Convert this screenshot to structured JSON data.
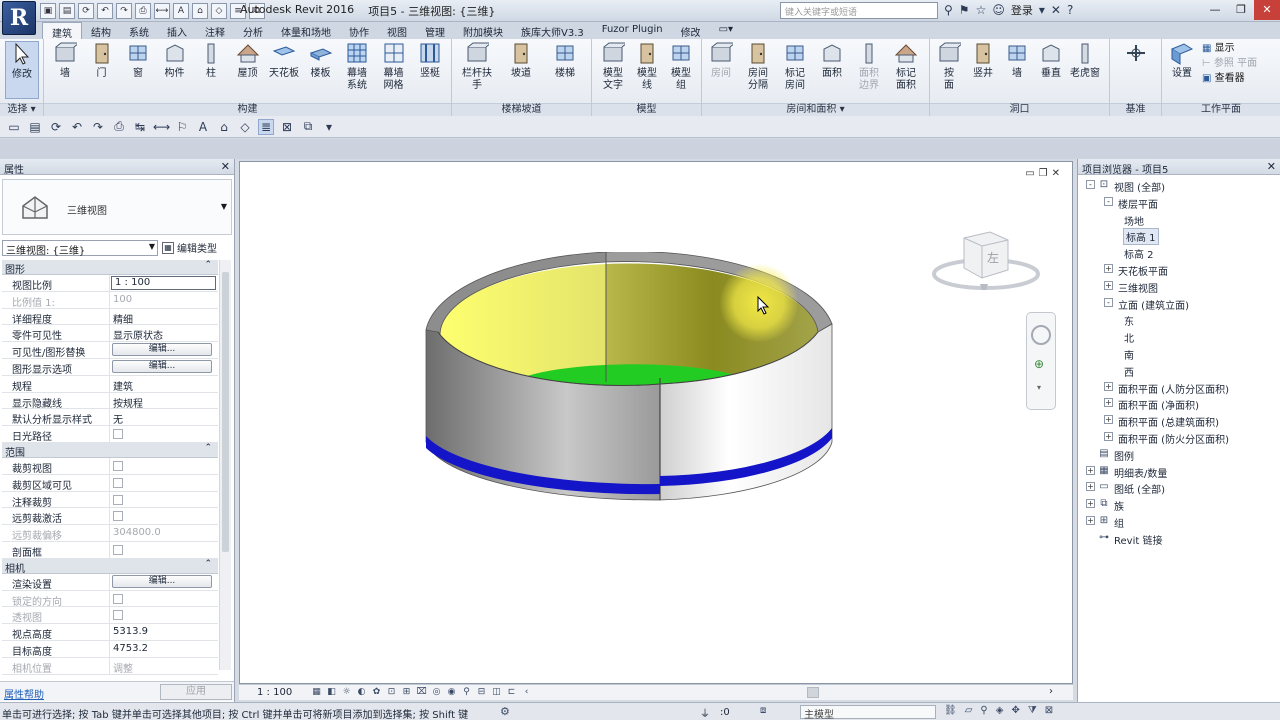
{
  "title_bar": {
    "app_title": "Autodesk Revit 2016",
    "project_view": "项目5 - 三维视图: {三维}",
    "search_placeholder": "键入关键字或短语",
    "login_label": "登录"
  },
  "ribbon_tabs": [
    "建筑",
    "结构",
    "系统",
    "插入",
    "注释",
    "分析",
    "体量和场地",
    "协作",
    "视图",
    "管理",
    "附加模块",
    "族库大师V3.3",
    "Fuzor Plugin",
    "修改"
  ],
  "active_tab": "建筑",
  "ribbon": {
    "select": {
      "modify": "修改",
      "label": "选择 ▾"
    },
    "build": {
      "label": "构建",
      "buttons": [
        "墙",
        "门",
        "窗",
        "构件",
        "柱",
        "屋顶",
        "天花板",
        "楼板",
        "幕墙\n系统",
        "幕墙\n网格",
        "竖梃"
      ]
    },
    "circulation": {
      "label": "楼梯坡道",
      "buttons": [
        "栏杆扶手",
        "坡道",
        "楼梯"
      ]
    },
    "model": {
      "label": "模型",
      "buttons": [
        "模型\n文字",
        "模型\n线",
        "模型\n组"
      ]
    },
    "room_area": {
      "label": "房间和面积 ▾",
      "buttons": [
        "房间",
        "房间\n分隔",
        "标记\n房间",
        "面积",
        "面积\n边界",
        "标记\n面积"
      ]
    },
    "opening": {
      "label": "洞口",
      "buttons": [
        "按\n面",
        "竖井",
        "墙",
        "垂直",
        "老虎窗"
      ]
    },
    "datum": {
      "label": "基准",
      "buttons": [
        "",
        ""
      ]
    },
    "work_plane": {
      "label": "工作平面",
      "buttons": [
        "设置"
      ],
      "side": [
        "显示",
        "参照 平面",
        "查看器"
      ]
    }
  },
  "properties": {
    "title": "属性",
    "type_name": "三维视图",
    "view_filter": "三维视图: {三维}",
    "edit_type": "编辑类型",
    "sections": [
      {
        "name": "图形",
        "rows": [
          {
            "k": "视图比例",
            "v": "1 : 100",
            "style": "boxed"
          },
          {
            "k": "比例值 1:",
            "v": "100",
            "style": "dim"
          },
          {
            "k": "详细程度",
            "v": "精细"
          },
          {
            "k": "零件可见性",
            "v": "显示原状态"
          },
          {
            "k": "可见性/图形替换",
            "v": "编辑...",
            "style": "button"
          },
          {
            "k": "图形显示选项",
            "v": "编辑...",
            "style": "button"
          },
          {
            "k": "规程",
            "v": "建筑"
          },
          {
            "k": "显示隐藏线",
            "v": "按规程"
          },
          {
            "k": "默认分析显示样式",
            "v": "无"
          },
          {
            "k": "日光路径",
            "v": "",
            "style": "check"
          }
        ]
      },
      {
        "name": "范围",
        "rows": [
          {
            "k": "裁剪视图",
            "v": "",
            "style": "check"
          },
          {
            "k": "裁剪区域可见",
            "v": "",
            "style": "check"
          },
          {
            "k": "注释裁剪",
            "v": "",
            "style": "check"
          },
          {
            "k": "远剪裁激活",
            "v": "",
            "style": "check"
          },
          {
            "k": "远剪裁偏移",
            "v": "304800.0",
            "style": "dim"
          },
          {
            "k": "剖面框",
            "v": "",
            "style": "check"
          }
        ]
      },
      {
        "name": "相机",
        "rows": [
          {
            "k": "渲染设置",
            "v": "编辑...",
            "style": "button"
          },
          {
            "k": "锁定的方向",
            "v": "",
            "style": "check-dim"
          },
          {
            "k": "透视图",
            "v": "",
            "style": "check-dim"
          },
          {
            "k": "视点高度",
            "v": "5313.9"
          },
          {
            "k": "目标高度",
            "v": "4753.2"
          },
          {
            "k": "相机位置",
            "v": "调整",
            "style": "dim"
          }
        ]
      }
    ],
    "help_link": "属性帮助",
    "apply_label": "应用"
  },
  "browser": {
    "title": "项目浏览器 - 项目5",
    "tree": [
      {
        "label": "视图 (全部)",
        "depth": 0,
        "exp": "-",
        "icon": "views-icon"
      },
      {
        "label": "楼层平面",
        "depth": 1,
        "exp": "-"
      },
      {
        "label": "场地",
        "depth": 2
      },
      {
        "label": "标高 1",
        "depth": 2,
        "selected": true
      },
      {
        "label": "标高 2",
        "depth": 2
      },
      {
        "label": "天花板平面",
        "depth": 1,
        "exp": "+"
      },
      {
        "label": "三维视图",
        "depth": 1,
        "exp": "+"
      },
      {
        "label": "立面 (建筑立面)",
        "depth": 1,
        "exp": "-"
      },
      {
        "label": "东",
        "depth": 2
      },
      {
        "label": "北",
        "depth": 2
      },
      {
        "label": "南",
        "depth": 2
      },
      {
        "label": "西",
        "depth": 2
      },
      {
        "label": "面积平面 (人防分区面积)",
        "depth": 1,
        "exp": "+"
      },
      {
        "label": "面积平面 (净面积)",
        "depth": 1,
        "exp": "+"
      },
      {
        "label": "面积平面 (总建筑面积)",
        "depth": 1,
        "exp": "+"
      },
      {
        "label": "面积平面 (防火分区面积)",
        "depth": 1,
        "exp": "+"
      },
      {
        "label": "图例",
        "depth": 0,
        "icon": "legend-icon"
      },
      {
        "label": "明细表/数量",
        "depth": 0,
        "exp": "+",
        "icon": "schedule-icon"
      },
      {
        "label": "图纸 (全部)",
        "depth": 0,
        "exp": "+",
        "icon": "sheet-icon"
      },
      {
        "label": "族",
        "depth": 0,
        "exp": "+",
        "icon": "family-icon"
      },
      {
        "label": "组",
        "depth": 0,
        "exp": "+",
        "icon": "group-icon"
      },
      {
        "label": "Revit 链接",
        "depth": 0,
        "icon": "link-icon"
      }
    ]
  },
  "view_bar": {
    "scale": "1 : 100"
  },
  "viewcube": {
    "face_label": "左"
  },
  "status": {
    "text": "单击可进行选择; 按 Tab 键并单击可选择其他项目; 按 Ctrl 键并单击可将新项目添加到选择集; 按 Shift 键",
    "count": ":0",
    "model_label": "主模型"
  },
  "colors": {
    "wall_inner_light": "#ffff70",
    "wall_inner_dark": "#8a8a20",
    "floor": "#22cc22",
    "stripe": "#1414c8",
    "halo": "#f5eb46"
  }
}
